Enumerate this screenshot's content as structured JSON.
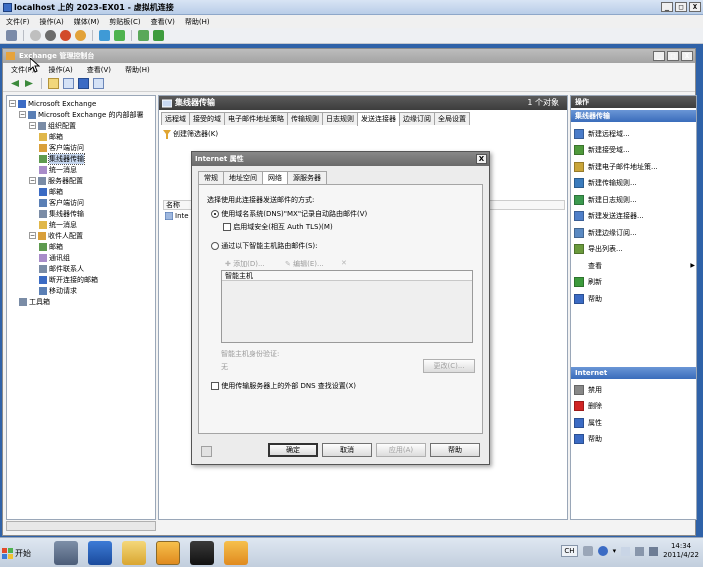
{
  "vm": {
    "title": "localhost 上的 2023-EX01 - 虚拟机连接",
    "menu": [
      "文件(F)",
      "操作(A)",
      "媒体(M)",
      "剪贴板(C)",
      "查看(V)",
      "帮助(H)"
    ],
    "buttons": [
      "_",
      "□",
      "X"
    ]
  },
  "exchange": {
    "title": "Exchange 管理控制台",
    "menu": [
      "文件(F)",
      "操作(A)",
      "查看(V)",
      "帮助(H)"
    ],
    "buttons": [
      "_",
      "□",
      "X"
    ]
  },
  "tree": [
    {
      "label": "Microsoft Exchange",
      "depth": 0,
      "expander": "−"
    },
    {
      "label": "Microsoft Exchange 的内部部署",
      "depth": 1,
      "expander": "−"
    },
    {
      "label": "组织配置",
      "depth": 2,
      "expander": "−"
    },
    {
      "label": "邮箱",
      "depth": 3,
      "expander": ""
    },
    {
      "label": "客户端访问",
      "depth": 3,
      "expander": ""
    },
    {
      "label": "集线器传输",
      "depth": 3,
      "expander": "",
      "selected": true
    },
    {
      "label": "统一消息",
      "depth": 3,
      "expander": ""
    },
    {
      "label": "服务器配置",
      "depth": 2,
      "expander": "−"
    },
    {
      "label": "邮箱",
      "depth": 3,
      "expander": ""
    },
    {
      "label": "客户端访问",
      "depth": 3,
      "expander": ""
    },
    {
      "label": "集线器传输",
      "depth": 3,
      "expander": ""
    },
    {
      "label": "统一消息",
      "depth": 3,
      "expander": ""
    },
    {
      "label": "收件人配置",
      "depth": 2,
      "expander": "−"
    },
    {
      "label": "邮箱",
      "depth": 3,
      "expander": ""
    },
    {
      "label": "通讯组",
      "depth": 3,
      "expander": ""
    },
    {
      "label": "邮件联系人",
      "depth": 3,
      "expander": ""
    },
    {
      "label": "断开连接的邮箱",
      "depth": 3,
      "expander": ""
    },
    {
      "label": "移动请求",
      "depth": 3,
      "expander": ""
    },
    {
      "label": "工具箱",
      "depth": 1,
      "expander": ""
    }
  ],
  "center": {
    "title": "集线器传输",
    "count": "1 个对象",
    "tabs": [
      "远程域",
      "接受的域",
      "电子邮件地址策略",
      "传输规则",
      "日志规则",
      "发送连接器",
      "边缘订阅",
      "全局设置"
    ],
    "active_tab": 5,
    "filter": "创建筛选器(K)",
    "column": "名称",
    "row": "Inte"
  },
  "actions": {
    "header": "操作",
    "section1": "集线器传输",
    "items1": [
      {
        "label": "新建远程域...",
        "icon": "remote-domain-icon",
        "color": "#4a7cc9"
      },
      {
        "label": "新建接受域...",
        "icon": "accepted-domain-icon",
        "color": "#4f9a3c"
      },
      {
        "label": "新建电子邮件地址策...",
        "icon": "email-policy-icon",
        "color": "#c9a53a"
      },
      {
        "label": "新建传输规则...",
        "icon": "transport-rule-icon",
        "color": "#3a7bbd"
      },
      {
        "label": "新建日志规则...",
        "icon": "journal-rule-icon",
        "color": "#3c9a4f"
      },
      {
        "label": "新建发送连接器...",
        "icon": "send-connector-icon",
        "color": "#4f7fc9"
      },
      {
        "label": "新建边缘订阅...",
        "icon": "edge-subscription-icon",
        "color": "#5a89c2"
      },
      {
        "label": "导出列表...",
        "icon": "export-list-icon",
        "color": "#6a9a3c"
      },
      {
        "label": "查看",
        "icon": "view-icon",
        "color": "",
        "submenu": true
      },
      {
        "label": "刷新",
        "icon": "refresh-icon",
        "color": "#3c9a3c"
      },
      {
        "label": "帮助",
        "icon": "help-icon",
        "color": "#3b6bc4"
      }
    ],
    "section2": "Internet",
    "items2": [
      {
        "label": "禁用",
        "icon": "disable-icon",
        "color": "#888888"
      },
      {
        "label": "删除",
        "icon": "delete-icon",
        "color": "#d02424"
      },
      {
        "label": "属性",
        "icon": "properties-icon",
        "color": "#3b6bc4"
      },
      {
        "label": "帮助",
        "icon": "help-icon",
        "color": "#3b6bc4"
      }
    ]
  },
  "dialog": {
    "title": "Internet 属性",
    "close": "X",
    "tabs": [
      "常规",
      "地址空间",
      "网络",
      "源服务器"
    ],
    "active_tab": 2,
    "heading": "选择使用此连接器发送邮件的方式:",
    "radio_dns": "使用域名系统(DNS)\"MX\"记录自动路由邮件(V)",
    "checkbox_tls": "启用域安全(相互 Auth TLS)(M)",
    "radio_smarthost": "通过以下智能主机路由邮件(S):",
    "add": "添加(D)...",
    "edit": "编辑(E)...",
    "delete": "✕",
    "list_header": "智能主机",
    "auth_label": "智能主机身份验证:",
    "auth_value": "无",
    "change": "更改(C)...",
    "checkbox_external_dns": "使用传输服务器上的外部 DNS 查找设置(X)",
    "ok": "确定",
    "cancel": "取消",
    "apply": "应用(A)",
    "help": "帮助"
  },
  "taskbar": {
    "start": "开始",
    "lang": "CH",
    "time": "14:34",
    "date": "2011/4/22"
  }
}
